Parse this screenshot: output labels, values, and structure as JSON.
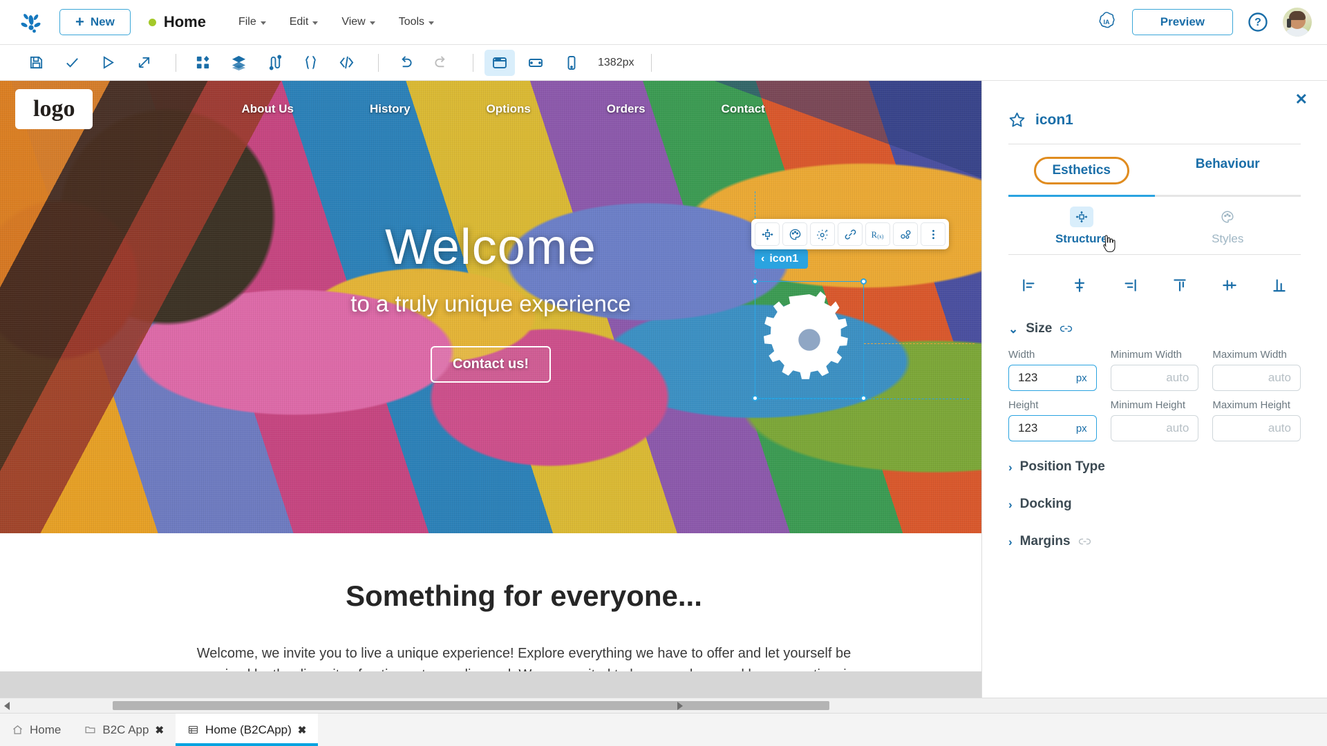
{
  "header": {
    "brand_icon": "frog-logo-icon",
    "new_button": "New",
    "page_status_color": "#a4c92a",
    "page_title": "Home",
    "menus": [
      "File",
      "Edit",
      "View",
      "Tools"
    ],
    "ia_badge": "IA",
    "preview_button": "Preview",
    "help_icon": "question-circle-icon",
    "avatar": "user-avatar"
  },
  "toolbar": {
    "items": [
      {
        "name": "save-icon"
      },
      {
        "name": "check-icon"
      },
      {
        "name": "run-icon"
      },
      {
        "name": "deploy-icon"
      }
    ],
    "items2": [
      {
        "name": "components-icon"
      },
      {
        "name": "layers-icon"
      },
      {
        "name": "logic-icon"
      },
      {
        "name": "braces-icon"
      },
      {
        "name": "code-icon"
      }
    ],
    "history": [
      {
        "name": "undo-icon"
      },
      {
        "name": "redo-icon"
      }
    ],
    "devices": [
      {
        "name": "desktop-view-icon",
        "active": true
      },
      {
        "name": "tablet-view-icon",
        "active": false
      },
      {
        "name": "mobile-view-icon",
        "active": false
      }
    ],
    "zoom_value": "1382px"
  },
  "canvas": {
    "site_nav": {
      "logo": "logo",
      "links": [
        "About Us",
        "History",
        "Options",
        "Orders",
        "Contact"
      ]
    },
    "hero": {
      "title": "Welcome",
      "subtitle": "to a truly unique experience",
      "cta": "Contact us!"
    },
    "card": {
      "heading": "Something for everyone...",
      "paragraph": "Welcome, we invite you to live a unique experience! Explore everything we have to offer and let yourself be surprised by the diversity of options at your disposal. We are excited to have you here and hope your time in our space is as special as you imagined."
    },
    "selection": {
      "label": "icon1",
      "element_icon": "gear-icon",
      "accent_color": "#2aa3e0"
    },
    "float_toolbar": [
      {
        "name": "move-structure-icon"
      },
      {
        "name": "palette-icon"
      },
      {
        "name": "settings-sparkle-icon"
      },
      {
        "name": "link-icon"
      },
      {
        "name": "rx-function-icon"
      },
      {
        "name": "relations-icon"
      },
      {
        "name": "more-options-icon"
      }
    ]
  },
  "panel": {
    "close_icon": "close-icon",
    "star_icon": "star-icon",
    "title": "icon1",
    "tabs": [
      {
        "label": "Esthetics",
        "active": true
      },
      {
        "label": "Behaviour",
        "active": false
      }
    ],
    "subtabs": [
      {
        "label": "Structure",
        "icon": "structure-icon",
        "active": true
      },
      {
        "label": "Styles",
        "icon": "palette-icon",
        "active": false
      }
    ],
    "align_buttons": [
      {
        "name": "align-left-icon"
      },
      {
        "name": "align-center-horizontal-icon"
      },
      {
        "name": "align-right-icon"
      },
      {
        "name": "align-top-icon"
      },
      {
        "name": "align-center-vertical-icon"
      },
      {
        "name": "align-bottom-icon"
      }
    ],
    "sections": [
      {
        "label": "Size",
        "expanded": true,
        "link_icon": "link-icon"
      },
      {
        "label": "Position Type",
        "expanded": false
      },
      {
        "label": "Docking",
        "expanded": false
      },
      {
        "label": "Margins",
        "expanded": false,
        "link_icon": "link-icon"
      }
    ],
    "size_fields": {
      "width": {
        "label": "Width",
        "value": "123",
        "unit": "px",
        "focused": true
      },
      "min_width": {
        "label": "Minimum Width",
        "value": "",
        "placeholder": "auto"
      },
      "max_width": {
        "label": "Maximum Width",
        "value": "",
        "placeholder": "auto"
      },
      "height": {
        "label": "Height",
        "value": "123",
        "unit": "px",
        "focused": true
      },
      "min_height": {
        "label": "Minimum Height",
        "value": "",
        "placeholder": "auto"
      },
      "max_height": {
        "label": "Maximum Height",
        "value": "",
        "placeholder": "auto"
      }
    }
  },
  "bottom": {
    "tabs": [
      {
        "label": "Home",
        "icon": "home-icon",
        "closable": false,
        "active": false
      },
      {
        "label": "B2C App",
        "icon": "folder-icon",
        "closable": true,
        "active": false
      },
      {
        "label": "Home (B2CApp)",
        "icon": "page-icon",
        "closable": true,
        "active": true
      }
    ],
    "close_label": "✖"
  }
}
